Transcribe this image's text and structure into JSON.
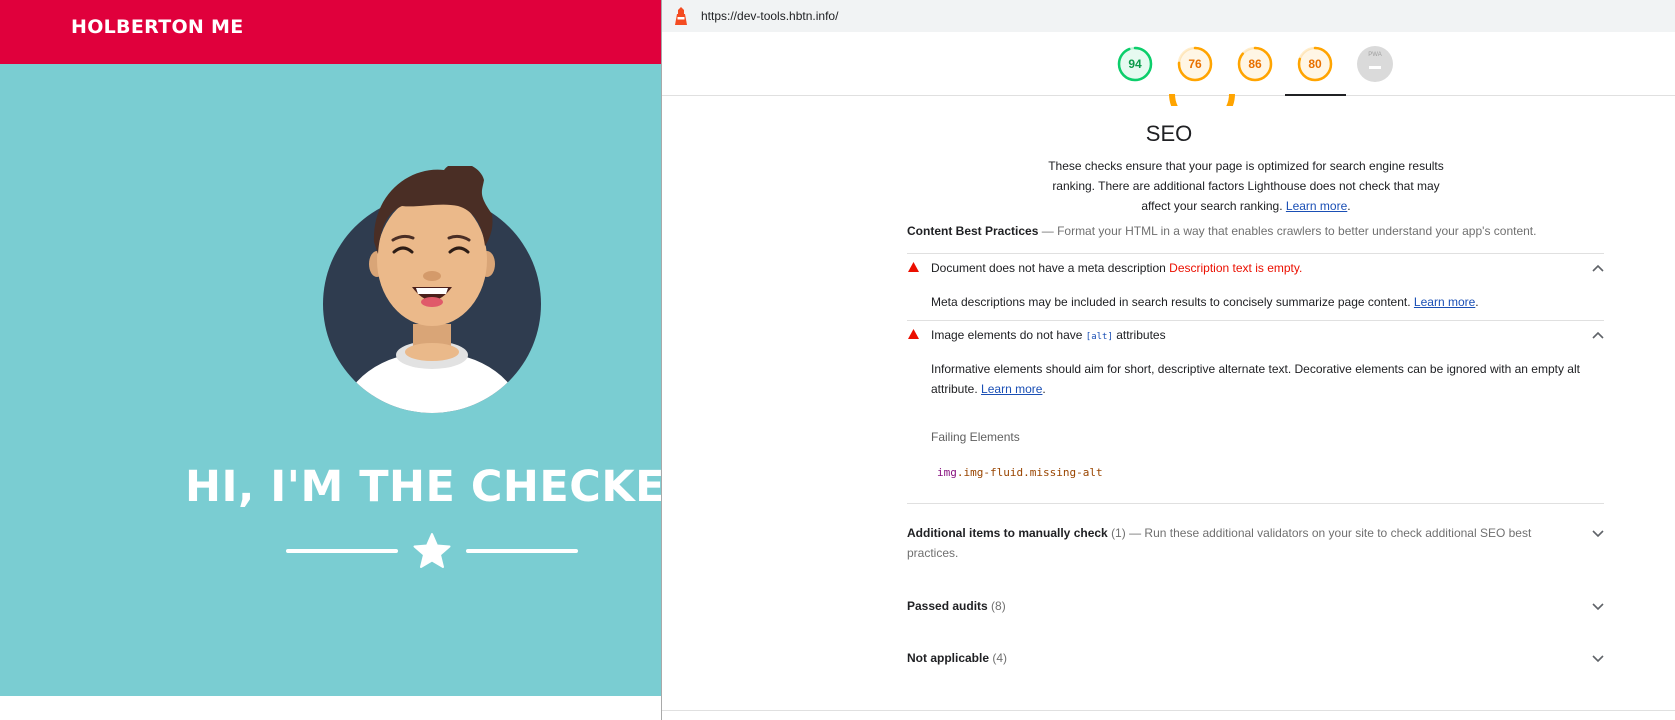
{
  "site": {
    "brand": "HOLBERTON ME",
    "hero_title": "HI, I'M THE CHECKER",
    "colors": {
      "navbar": "#e0003c",
      "hero": "#7acdd2"
    }
  },
  "devtools": {
    "url": "https://dev-tools.hbtn.info/",
    "gauges": [
      {
        "value": "94",
        "score": 0.94,
        "color": "#0cce6b"
      },
      {
        "value": "76",
        "score": 0.76,
        "color": "#ffa400"
      },
      {
        "value": "86",
        "score": 0.86,
        "color": "#ffa400"
      },
      {
        "value": "80",
        "score": 0.8,
        "color": "#ffa400"
      },
      {
        "value": "PWA",
        "score": 0,
        "color": "#dadada"
      }
    ],
    "seo": {
      "title": "SEO",
      "description": "These checks ensure that your page is optimized for search engine results ranking. There are additional factors Lighthouse does not check that may affect your search ranking.",
      "learn_more": "Learn more",
      "end_period": "."
    },
    "group": {
      "title": "Content Best Practices",
      "separator": "—",
      "description": "Format your HTML in a way that enables crawlers to better understand your app's content."
    },
    "audit1": {
      "title": "Document does not have a meta description",
      "error": "Description text is empty.",
      "body": "Meta descriptions may be included in search results to concisely summarize page content.",
      "learn_more": "Learn more",
      "end_period": "."
    },
    "audit2": {
      "title_before": "Image elements do not have",
      "code": "[alt]",
      "title_after": "attributes",
      "body": "Informative elements should aim for short, descriptive alternate text. Decorative elements can be ignored with an empty alt attribute.",
      "learn_more": "Learn more",
      "end_period": ".",
      "failing_label": "Failing Elements",
      "failing_tag": "img",
      "failing_classes": ".img-fluid.missing-alt"
    },
    "manual": {
      "title": "Additional items to manually check",
      "count": "(1)",
      "separator": "—",
      "description": "Run these additional validators on your site to check additional SEO best practices."
    },
    "passed": {
      "title": "Passed audits",
      "count": "(8)"
    },
    "not_applicable": {
      "title": "Not applicable",
      "count": "(4)"
    }
  }
}
